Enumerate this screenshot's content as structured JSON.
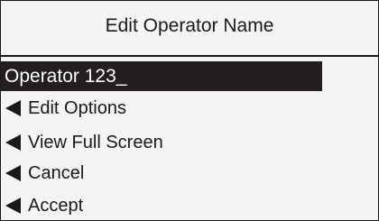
{
  "screen": {
    "title": "Edit Operator Name",
    "input_value": "Operator 123_"
  },
  "menu": {
    "items": [
      {
        "label": "Edit Options",
        "icon": "left-arrow-icon"
      },
      {
        "label": "View Full Screen",
        "icon": "left-arrow-icon"
      },
      {
        "label": "Cancel",
        "icon": "left-arrow-icon"
      },
      {
        "label": "Accept",
        "icon": "left-arrow-icon"
      }
    ]
  },
  "colors": {
    "background": "#f4f4f4",
    "text": "#1a1a1a",
    "field_background": "#231f20",
    "field_text": "#ffffff"
  }
}
